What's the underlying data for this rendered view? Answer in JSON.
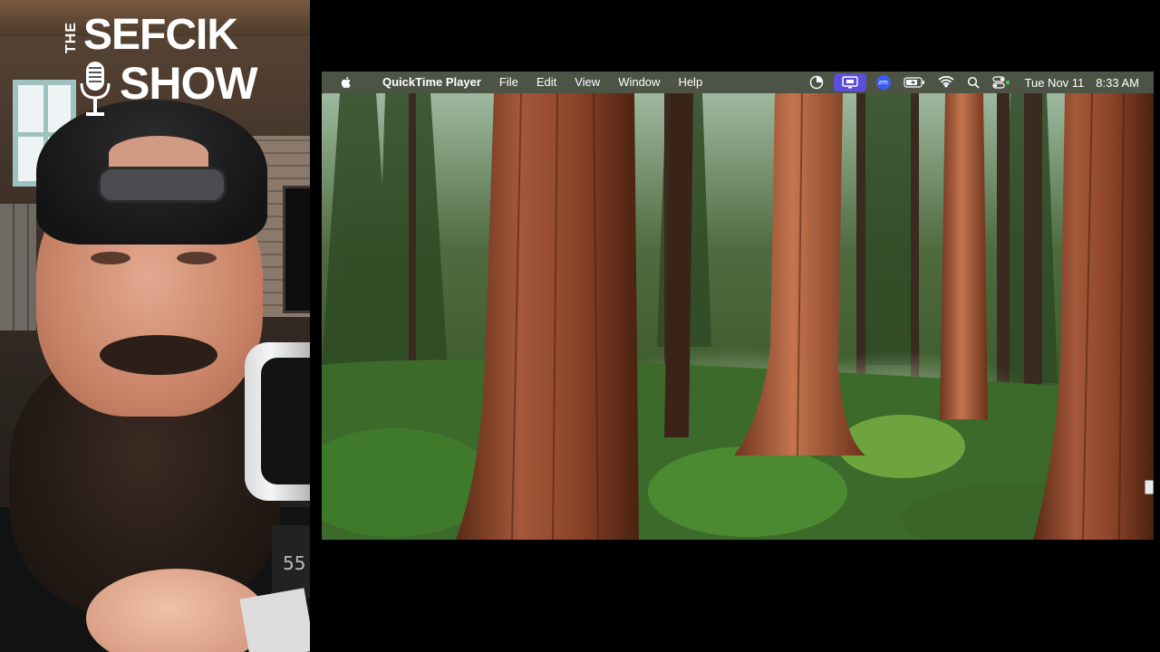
{
  "webcam": {
    "logo": {
      "the": "THE",
      "line1": "SEFCIK",
      "line2": "SHOW"
    },
    "mic_label": "55"
  },
  "screen_share": {
    "menubar": {
      "app_name": "QuickTime Player",
      "menus": [
        "File",
        "Edit",
        "View",
        "Window",
        "Help"
      ],
      "status_icons": [
        "screen-time-icon",
        "screen-sharing-icon",
        "zoom-icon",
        "battery-icon",
        "wifi-icon",
        "spotlight-search-icon",
        "control-center-icon"
      ],
      "clock_date": "Tue Nov 11",
      "clock_time": "8:33 AM"
    },
    "wallpaper": "sequoia-forest",
    "colors": {
      "menubar": "#4d5446",
      "active_tray": "#5a4fd9",
      "zoom": "#3b5bf7"
    }
  }
}
